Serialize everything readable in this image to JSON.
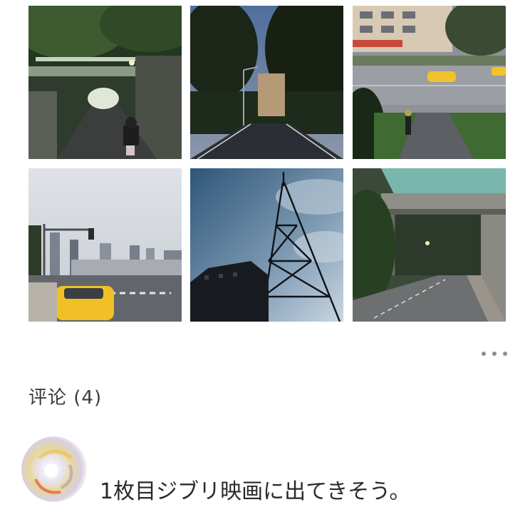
{
  "gallery": {
    "photos": [
      {
        "name": "overpass-street-with-scooter-rider"
      },
      {
        "name": "dusk-road-with-streetlamp"
      },
      {
        "name": "street-with-taxis-and-cleaner"
      },
      {
        "name": "city-intersection-with-yellow-taxi"
      },
      {
        "name": "steel-lattice-tower"
      },
      {
        "name": "bridge-over-empty-road"
      }
    ]
  },
  "more_menu": {
    "icon": "more-dots-icon"
  },
  "comments": {
    "title": "评论 (4)",
    "items": [
      {
        "text": "1枚目ジブリ映画に出てきそう。",
        "avatar_icon": "swirl-avatar"
      }
    ]
  }
}
